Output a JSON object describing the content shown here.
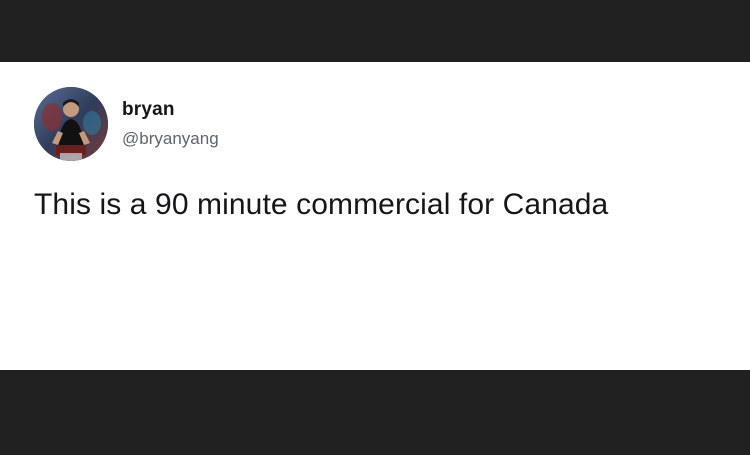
{
  "tweet": {
    "display_name": "bryan",
    "handle": "@bryanyang",
    "text": "This is a 90 minute commercial for Canada",
    "avatar_icon": "profile-photo"
  },
  "colors": {
    "frame_background": "#212121",
    "card_background": "#ffffff",
    "name_color": "#14171a",
    "handle_color": "#5b6670",
    "text_color": "#14171a"
  }
}
